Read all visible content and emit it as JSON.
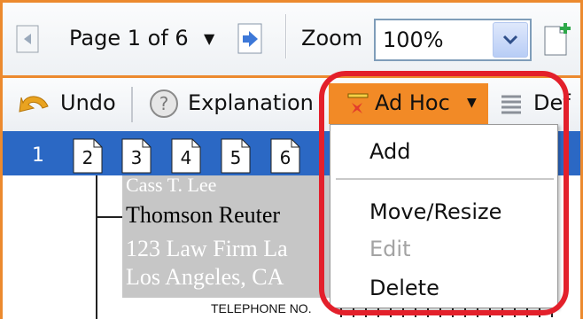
{
  "toolbar": {
    "page_text": "Page 1 of 6",
    "zoom_label": "Zoom",
    "zoom_value": "100%"
  },
  "toolbar2": {
    "undo_label": "Undo",
    "explanation_label": "Explanation",
    "adhoc_label": "Ad Hoc",
    "default_label": "Def"
  },
  "page_tabs": {
    "current": "1",
    "pages": [
      "2",
      "3",
      "4",
      "5",
      "6"
    ]
  },
  "document": {
    "lines": [
      "Cass T. Lee",
      "Thomson Reuter",
      "123 Law Firm La",
      "Los Angeles, CA",
      "TELEPHONE NO."
    ]
  },
  "menu": {
    "items": [
      {
        "label": "Add",
        "enabled": true
      },
      {
        "label": "Move/Resize",
        "enabled": true
      },
      {
        "label": "Edit",
        "enabled": false
      },
      {
        "label": "Delete",
        "enabled": true
      }
    ]
  },
  "colors": {
    "accent_orange": "#f28a26",
    "pagebar_blue": "#2b68c4",
    "highlight_red": "#e3202b"
  }
}
